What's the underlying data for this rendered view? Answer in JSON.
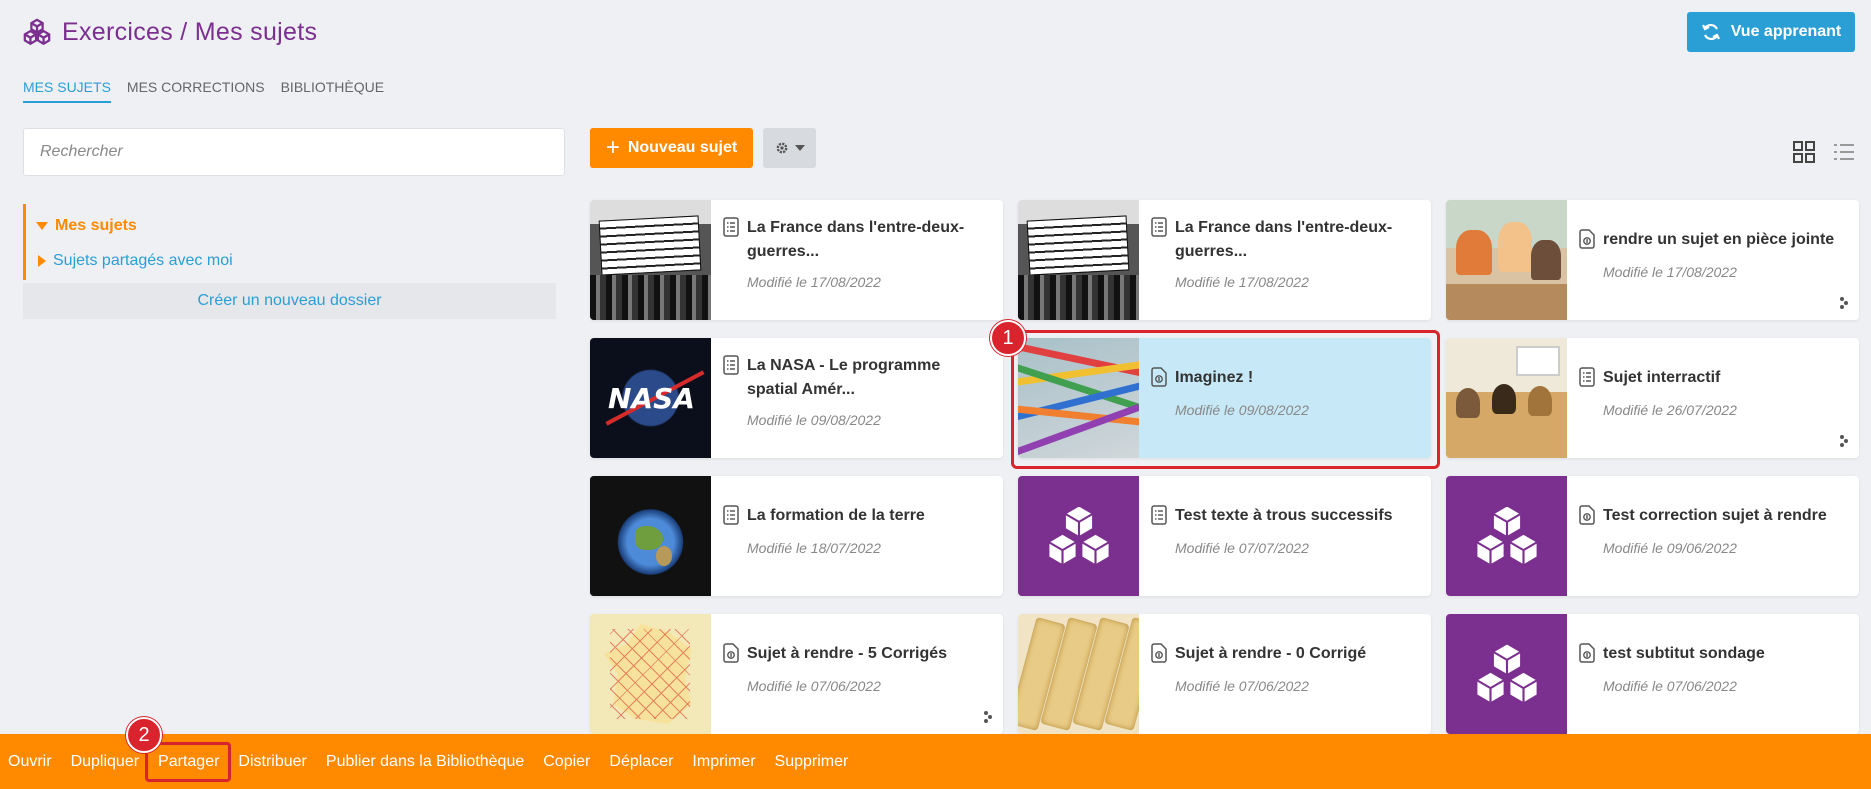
{
  "header": {
    "title": "Exercices / Mes sujets",
    "view_button": "Vue apprenant",
    "accent": "#7b2f8f"
  },
  "tabs": [
    {
      "label": "MES SUJETS",
      "active": true
    },
    {
      "label": "MES CORRECTIONS",
      "active": false
    },
    {
      "label": "BIBLIOTHÈQUE",
      "active": false
    }
  ],
  "sidebar": {
    "search_placeholder": "Rechercher",
    "folders": [
      {
        "label": "Mes sujets",
        "expanded": true
      },
      {
        "label": "Sujets partagés avec moi",
        "expanded": false
      }
    ],
    "new_folder": "Créer un nouveau dossier"
  },
  "toolbar": {
    "new_subject": "Nouveau sujet"
  },
  "cards": [
    {
      "title": "La France dans l'entre-deux-guerres...",
      "date": "Modifié le 17/08/2022",
      "thumb": "protest-photo",
      "icon": "list-doc-icon",
      "shared": false
    },
    {
      "title": "La France dans l'entre-deux-guerres...",
      "date": "Modifié le 17/08/2022",
      "thumb": "protest-photo",
      "icon": "list-doc-icon",
      "shared": false
    },
    {
      "title": "rendre un sujet en pièce jointe",
      "date": "Modifié le 17/08/2022",
      "thumb": "classroom-laptops-photo",
      "icon": "upload-doc-icon",
      "shared": true
    },
    {
      "title": "La NASA - Le programme spatial Amér...",
      "date": "Modifié le 09/08/2022",
      "thumb": "nasa-logo",
      "icon": "list-doc-icon",
      "shared": false
    },
    {
      "title": "Imaginez !",
      "date": "Modifié le 09/08/2022",
      "thumb": "pencils-photo",
      "icon": "upload-doc-icon",
      "shared": false,
      "selected": true
    },
    {
      "title": "Sujet interractif",
      "date": "Modifié le 26/07/2022",
      "thumb": "classroom-photo",
      "icon": "list-doc-icon",
      "shared": true
    },
    {
      "title": "La formation de la terre",
      "date": "Modifié le 18/07/2022",
      "thumb": "earth-photo",
      "icon": "list-doc-icon",
      "shared": false
    },
    {
      "title": "Test texte à trous successifs",
      "date": "Modifié le 07/07/2022",
      "thumb": "cubes-logo",
      "icon": "list-doc-icon",
      "shared": false
    },
    {
      "title": "Test correction sujet à rendre",
      "date": "Modifié le 09/06/2022",
      "thumb": "cubes-logo",
      "icon": "upload-doc-icon",
      "shared": false
    },
    {
      "title": "Sujet à rendre - 5 Corrigés",
      "date": "Modifié le 07/06/2022",
      "thumb": "france-map",
      "icon": "upload-doc-icon",
      "shared": true
    },
    {
      "title": "Sujet à rendre - 0 Corrigé",
      "date": "Modifié le 07/06/2022",
      "thumb": "bread-photo",
      "icon": "upload-doc-icon",
      "shared": false
    },
    {
      "title": "test subtitut sondage",
      "date": "Modifié le 07/06/2022",
      "thumb": "cubes-logo",
      "icon": "upload-doc-icon",
      "shared": false
    }
  ],
  "actions": [
    "Ouvrir",
    "Dupliquer",
    "Partager",
    "Distribuer",
    "Publier dans la Bibliothèque",
    "Copier",
    "Déplacer",
    "Imprimer",
    "Supprimer"
  ],
  "callouts": [
    {
      "number": "1",
      "target": "card-imaginez"
    },
    {
      "number": "2",
      "target": "action-partager"
    }
  ],
  "colors": {
    "orange": "#ff8a00",
    "blue": "#2a9fd6",
    "purple": "#7b2f8f",
    "selected": "#c6e8f7",
    "callout_red": "#d9232d"
  }
}
